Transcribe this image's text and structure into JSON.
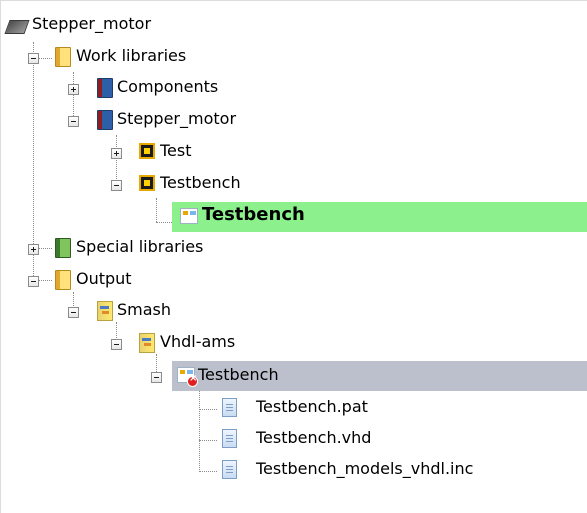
{
  "tree": {
    "root": {
      "label": "Stepper_motor",
      "icon": "project-icon"
    },
    "work_libraries": {
      "label": "Work libraries",
      "icon": "yellow-library-icon",
      "expanded": true
    },
    "components": {
      "label": "Components",
      "icon": "blue-library-icon",
      "expanded": false
    },
    "stepper_lib": {
      "label": "Stepper_motor",
      "icon": "blue-library-icon",
      "expanded": true
    },
    "test": {
      "label": "Test",
      "icon": "chip-icon",
      "expanded": false
    },
    "testbench_unit": {
      "label": "Testbench",
      "icon": "chip-icon",
      "expanded": true
    },
    "testbench_arch": {
      "label": "Testbench",
      "icon": "testbench-icon",
      "selected": true,
      "selection_color": "#8cf08c"
    },
    "special_libraries": {
      "label": "Special libraries",
      "icon": "green-library-icon",
      "expanded": false
    },
    "output": {
      "label": "Output",
      "icon": "yellow-library-icon",
      "expanded": true
    },
    "smash": {
      "label": "Smash",
      "icon": "smash-icon",
      "expanded": true
    },
    "vhdl_ams": {
      "label": "Vhdl-ams",
      "icon": "smash-icon",
      "expanded": true
    },
    "testbench_out": {
      "label": "Testbench",
      "icon": "testbench-error-icon",
      "highlight_color": "#bcc0cc",
      "expanded": true
    },
    "files": [
      {
        "label": "Testbench.pat",
        "icon": "document-icon"
      },
      {
        "label": "Testbench.vhd",
        "icon": "document-icon"
      },
      {
        "label": "Testbench_models_vhdl.inc",
        "icon": "document-icon"
      }
    ]
  }
}
